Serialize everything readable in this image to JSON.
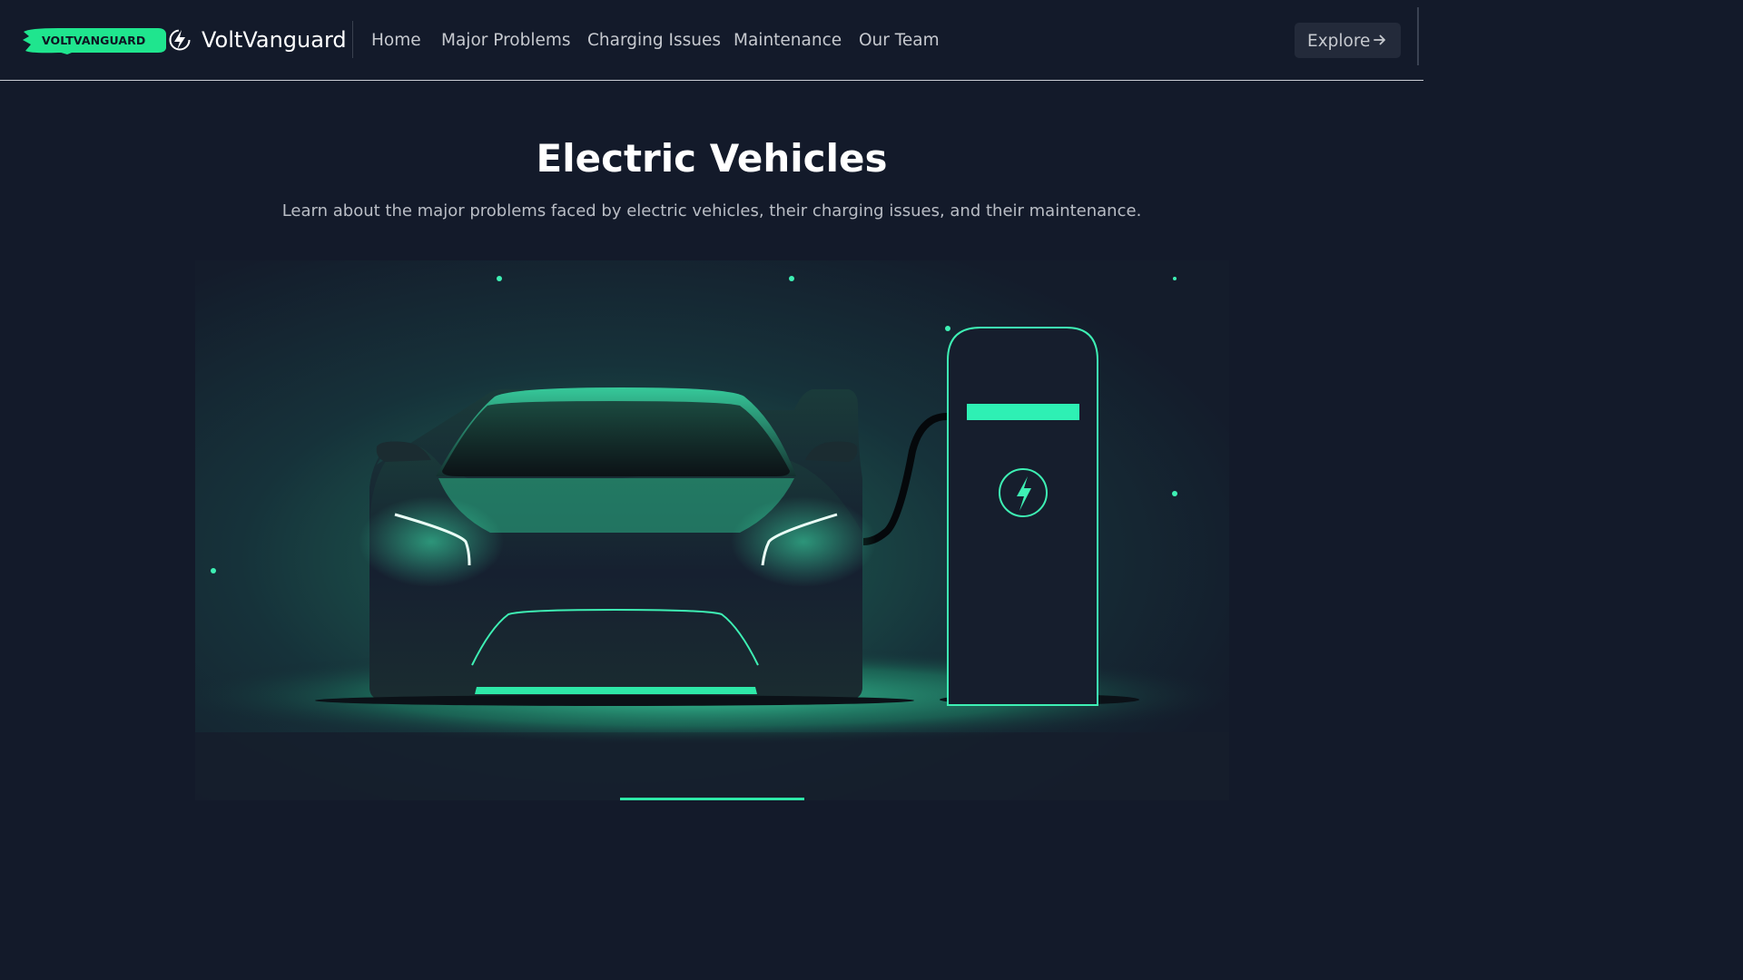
{
  "brand": {
    "badge_text": "VOLTVANGUARD",
    "name": "VoltVanguard",
    "badge_color": "#1fe58e",
    "logo_icon": "bolt-icon"
  },
  "nav": {
    "links": [
      {
        "label": "Home"
      },
      {
        "label": "Major Problems"
      },
      {
        "label": "Charging Issues"
      },
      {
        "label": "Maintenance"
      },
      {
        "label": "Our Team"
      }
    ],
    "explore_label": "Explore",
    "explore_icon": "arrow-right-icon"
  },
  "hero": {
    "title": "Electric Vehicles",
    "subtitle": "Learn about the major problems faced by electric vehicles, their charging issues, and their maintenance.",
    "image_icon": "electric-car-charging-illustration"
  },
  "colors": {
    "background": "#131a2a",
    "accent": "#2ee8a8",
    "nav_text": "#c6c9cf"
  }
}
